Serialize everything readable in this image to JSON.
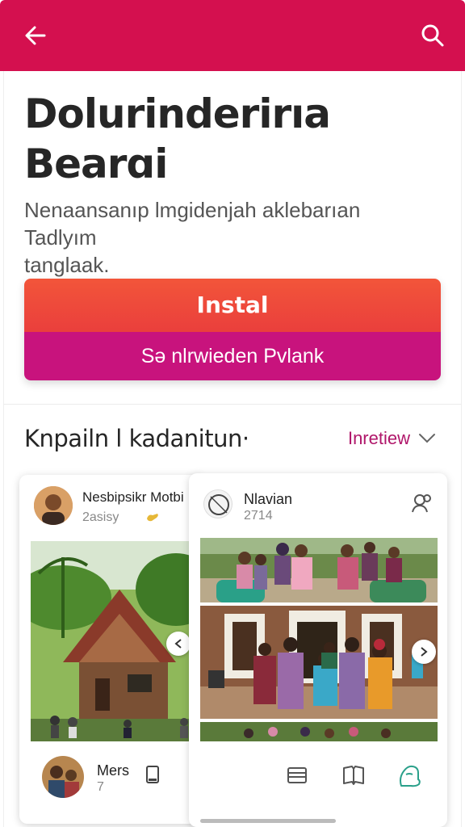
{
  "header": {
    "back_icon": "arrow-left-icon",
    "search_icon": "search-icon",
    "color": "#d4104f"
  },
  "hero": {
    "title_line1": "Dolurinderirıa",
    "title_line2": "Bearɑi",
    "subtitle_line1": "Nenaansanıp lmgidenjah aklebarıan Tadlyım",
    "subtitle_line2": "tanglaak."
  },
  "cta": {
    "install_label": "Instal",
    "secondary_label": "Sə nlrwieden Pvlank",
    "install_color": "#ea3f3c",
    "secondary_color": "#c8137d"
  },
  "section": {
    "title": "Knpailn l kadanitun·",
    "filter_label": "Inretiew",
    "filter_color": "#b0166a"
  },
  "cards": {
    "left": {
      "name": "Nesbipsikr Motbi",
      "meta": "2asisy",
      "footer_name": "Mers",
      "footer_count": "7"
    },
    "right": {
      "name": "Nlavian",
      "meta": "2714"
    }
  }
}
